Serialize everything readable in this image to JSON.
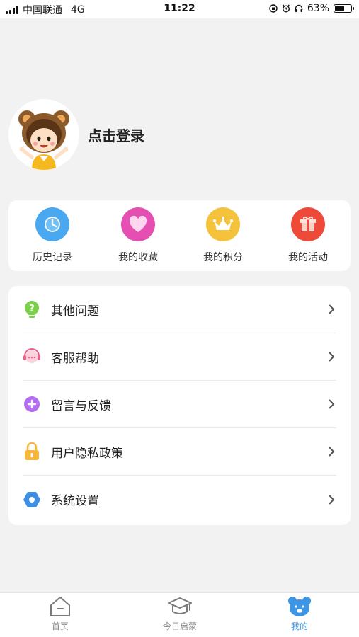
{
  "status_bar": {
    "carrier": "中国联通",
    "network": "4G",
    "time": "11:22",
    "battery_percent_text": "63%",
    "battery_level": 0.63
  },
  "profile": {
    "login_text": "点击登录"
  },
  "quick_actions": [
    {
      "label": "历史记录",
      "icon": "history-clock-icon",
      "color": "#4aa8f0"
    },
    {
      "label": "我的收藏",
      "icon": "favorite-heart-icon",
      "color": "#e54fb2"
    },
    {
      "label": "我的积分",
      "icon": "points-crown-icon",
      "color": "#f5c33b"
    },
    {
      "label": "我的活动",
      "icon": "activity-gift-icon",
      "color": "#ee4a3a"
    }
  ],
  "menu": [
    {
      "label": "其他问题",
      "icon": "question-icon",
      "color": "#7bd04a"
    },
    {
      "label": "客服帮助",
      "icon": "customer-service-icon",
      "color": "#ef5f86"
    },
    {
      "label": "留言与反馈",
      "icon": "feedback-plus-icon",
      "color": "#b46ef0"
    },
    {
      "label": "用户隐私政策",
      "icon": "lock-icon",
      "color": "#f6b73c"
    },
    {
      "label": "系统设置",
      "icon": "settings-hex-icon",
      "color": "#3d8fe6"
    }
  ],
  "tabs": [
    {
      "label": "首页",
      "icon": "home-icon",
      "active": false
    },
    {
      "label": "今日启蒙",
      "icon": "graduation-cap-icon",
      "active": false
    },
    {
      "label": "我的",
      "icon": "bear-icon",
      "active": true
    }
  ],
  "colors": {
    "accent": "#3d95e6",
    "background": "#f2f2f2"
  }
}
